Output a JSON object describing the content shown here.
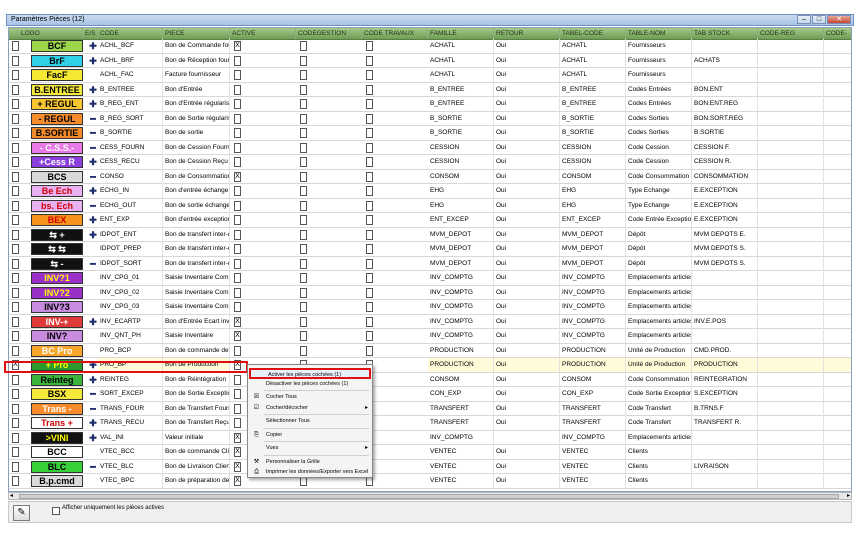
{
  "window": {
    "title": "Paramètres Pièces (12)",
    "min": "–",
    "max": "□",
    "close": "✕"
  },
  "columns": [
    "LOGO",
    "E/S",
    "CODE",
    "PIECE",
    "ACTIVE",
    "CODEGESTION",
    "CODE TRAVAUX",
    "FAMILLE",
    "RETOUR",
    "TABEL-CODE",
    "TABLE-NOM",
    "TAB STOCK",
    "CODE-REG",
    "CODE-"
  ],
  "rows": [
    {
      "logo": "BCF",
      "logo_bg": "#9ad54a",
      "logo_fg": "#000",
      "es": "✚",
      "code": "ACHL_BCF",
      "piece": "Bon de Commande fourni",
      "active": "X",
      "famille": "ACHATL",
      "retour": "Oui",
      "tabel": "ACHATL",
      "tnom": "Fournisseurs",
      "tstock": ""
    },
    {
      "logo": "BrF",
      "logo_bg": "#2fd0e8",
      "logo_fg": "#000",
      "es": "✚",
      "code": "ACHL_BRF",
      "piece": "Bon de Réception fournis",
      "active": "",
      "famille": "ACHATL",
      "retour": "Oui",
      "tabel": "ACHATL",
      "tnom": "Fournisseurs",
      "tstock": "ACHATS"
    },
    {
      "logo": "FacF",
      "logo_bg": "#f4e833",
      "logo_fg": "#000",
      "es": "",
      "code": "ACHL_FAC",
      "piece": "Facture fournisseur",
      "active": "",
      "famille": "ACHATL",
      "retour": "Oui",
      "tabel": "ACHATL",
      "tnom": "Fournisseurs",
      "tstock": ""
    },
    {
      "logo": "B.ENTREE",
      "logo_bg": "#f5e93c",
      "logo_fg": "#000",
      "es": "✚",
      "code": "B_ENTREE",
      "piece": "Bon d'Entrée",
      "active": "",
      "famille": "B_ENTREE",
      "retour": "Oui",
      "tabel": "B_ENTREE",
      "tnom": "Codes Entrées",
      "tstock": "BON.ENT"
    },
    {
      "logo": "+ REGUL",
      "logo_bg": "#f9c62f",
      "logo_fg": "#000",
      "es": "✚",
      "code": "B_REG_ENT",
      "piece": "Bon d'Entrée régularisatio",
      "active": "",
      "famille": "B_ENTREE",
      "retour": "Oui",
      "tabel": "B_ENTREE",
      "tnom": "Codes Entrées",
      "tstock": "BON.ENT.REG"
    },
    {
      "logo": "- REGUL",
      "logo_bg": "#f58b2a",
      "logo_fg": "#000",
      "es": "━",
      "code": "B_REG_SORT",
      "piece": "Bon de Sortie régularisati",
      "active": "",
      "famille": "B_SORTIE",
      "retour": "Oui",
      "tabel": "B_SORTIE",
      "tnom": "Codes Sorties",
      "tstock": "BON.SORT.REG"
    },
    {
      "logo": "B.SORTIE",
      "logo_bg": "#f58a2a",
      "logo_fg": "#000",
      "es": "━",
      "code": "B_SORTIE",
      "piece": "Bon de sortie",
      "active": "",
      "famille": "B_SORTIE",
      "retour": "Oui",
      "tabel": "B_SORTIE",
      "tnom": "Codes Sorties",
      "tstock": "B.SORTIE"
    },
    {
      "logo": "- C.S.S.-",
      "logo_bg": "#e979e9",
      "logo_fg": "#fff",
      "es": "━",
      "code": "CESS_FOURN",
      "piece": "Bon de Cession Fournie",
      "active": "",
      "famille": "CESSION",
      "retour": "Oui",
      "tabel": "CESSION",
      "tnom": "Code Cession",
      "tstock": "CESSION F."
    },
    {
      "logo": "+Cess R",
      "logo_bg": "#8a3fdc",
      "logo_fg": "#fff",
      "es": "✚",
      "code": "CESS_RECU",
      "piece": "Bon de Cession Reçu",
      "active": "",
      "famille": "CESSION",
      "retour": "Oui",
      "tabel": "CESSION",
      "tnom": "Code Cession",
      "tstock": "CESSION R."
    },
    {
      "logo": "BCS",
      "logo_bg": "#d9d9d9",
      "logo_fg": "#000",
      "es": "━",
      "code": "CONSO",
      "piece": "Bon de Consommation",
      "active": "X",
      "famille": "CONSOM",
      "retour": "Oui",
      "tabel": "CONSOM",
      "tnom": "Code Consommation",
      "tstock": "CONSOMMATION"
    },
    {
      "logo": "Be Ech",
      "logo_bg": "#e9b0f2",
      "logo_fg": "#c00",
      "es": "✚",
      "code": "ECHG_IN",
      "piece": "Bon d'entrée échange",
      "active": "",
      "famille": "EHG",
      "retour": "Oui",
      "tabel": "EHG",
      "tnom": "Type Echange",
      "tstock": "E.EXCEPTION"
    },
    {
      "logo": "bs. Ech",
      "logo_bg": "#e9b0f2",
      "logo_fg": "#c00",
      "es": "━",
      "code": "ECHG_OUT",
      "piece": "Bon de sortie échange",
      "active": "",
      "famille": "EHG",
      "retour": "Oui",
      "tabel": "EHG",
      "tnom": "Type Echange",
      "tstock": "E.EXCEPTION"
    },
    {
      "logo": "BEX",
      "logo_bg": "#f7941d",
      "logo_fg": "#c00",
      "es": "✚",
      "code": "ENT_EXP",
      "piece": "Bon d'entrée exception",
      "active": "",
      "famille": "ENT_EXCEP",
      "retour": "Oui",
      "tabel": "ENT_EXCEP",
      "tnom": "Code Entrée Exception",
      "tstock": "E.EXCEPTION"
    },
    {
      "logo": "⇆ +",
      "logo_bg": "#111",
      "logo_fg": "#fff",
      "es": "✚",
      "code": "IDPOT_ENT",
      "piece": "Bon de transfert inter-dép",
      "active": "",
      "famille": "MVM_DEPOT",
      "retour": "Oui",
      "tabel": "MVM_DEPOT",
      "tnom": "Dépôt",
      "tstock": "MVM DEPOTS E."
    },
    {
      "logo": "⇆ ⇆",
      "logo_bg": "#111",
      "logo_fg": "#fff",
      "es": "",
      "code": "IDPOT_PREP",
      "piece": "Bon de transfert inter-dép",
      "active": "",
      "famille": "MVM_DEPOT",
      "retour": "Oui",
      "tabel": "MVM_DEPOT",
      "tnom": "Dépôt",
      "tstock": "MVM DEPOTS S."
    },
    {
      "logo": "⇆ -",
      "logo_bg": "#111",
      "logo_fg": "#fff",
      "es": "━",
      "code": "IDPOT_SORT",
      "piece": "Bon de transfert inter-dép",
      "active": "",
      "famille": "MVM_DEPOT",
      "retour": "Oui",
      "tabel": "MVM_DEPOT",
      "tnom": "Dépôt",
      "tstock": "MVM DEPOTS S."
    },
    {
      "logo": "INV?1",
      "logo_bg": "#9b30c8",
      "logo_fg": "#ff0",
      "es": "",
      "code": "INV_CPG_01",
      "piece": "Saisie Inventaire Comptag",
      "active": "",
      "famille": "INV_COMPTG",
      "retour": "Oui",
      "tabel": "INV_COMPTG",
      "tnom": "Emplacements articles",
      "tstock": ""
    },
    {
      "logo": "INV?2",
      "logo_bg": "#9b30c8",
      "logo_fg": "#ff0",
      "es": "",
      "code": "INV_CPG_02",
      "piece": "Saisie Inventaire Comptag",
      "active": "",
      "famille": "INV_COMPTG",
      "retour": "Oui",
      "tabel": "INV_COMPTG",
      "tnom": "Emplacements articles",
      "tstock": ""
    },
    {
      "logo": "INV?3",
      "logo_bg": "#c98be0",
      "logo_fg": "#000",
      "es": "",
      "code": "INV_CPG_03",
      "piece": "Saisie Inventaire Comptag",
      "active": "",
      "famille": "INV_COMPTG",
      "retour": "Oui",
      "tabel": "INV_COMPTG",
      "tnom": "Emplacements articles",
      "tstock": ""
    },
    {
      "logo": "INV-+",
      "logo_bg": "#e03a3a",
      "logo_fg": "#fff",
      "es": "✚",
      "code": "INV_ECARTP",
      "piece": "Bon d'Entrée Ecart invent",
      "active": "X",
      "famille": "INV_COMPTG",
      "retour": "Oui",
      "tabel": "INV_COMPTG",
      "tnom": "Emplacements articles",
      "tstock": "INV.E.POS"
    },
    {
      "logo": "INV?",
      "logo_bg": "#c98be0",
      "logo_fg": "#000",
      "es": "",
      "code": "INV_QNT_PH",
      "piece": "Saisie Inventaire",
      "active": "X",
      "famille": "INV_COMPTG",
      "retour": "Oui",
      "tabel": "INV_COMPTG",
      "tnom": "Emplacements articles",
      "tstock": ""
    },
    {
      "logo": "BC Pro",
      "logo_bg": "#f7a52b",
      "logo_fg": "#fff",
      "es": "",
      "code": "PRO_BCP",
      "piece": "Bon de commande de Pro",
      "active": "",
      "famille": "PRODUCTION",
      "retour": "Oui",
      "tabel": "PRODUCTION",
      "tnom": "Unité de Production",
      "tstock": "CMD.PROD."
    },
    {
      "logo": "+ Pro",
      "logo_bg": "#2c9b2c",
      "logo_fg": "#ff0",
      "es": "✚",
      "code": "PRO_BP",
      "piece": "Bon de Production",
      "active": "X",
      "famille": "PRODUCTION",
      "retour": "Oui",
      "tabel": "PRODUCTION",
      "tnom": "Unité de Production",
      "tstock": "PRODUCTION",
      "first_chk": "X"
    },
    {
      "logo": "Reinteg",
      "logo_bg": "#3ab43a",
      "logo_fg": "#000",
      "es": "✚",
      "code": "REINTEG",
      "piece": "Bon de Réintégration",
      "active": "",
      "famille": "CONSOM",
      "retour": "Oui",
      "tabel": "CONSOM",
      "tnom": "Code Consommation",
      "tstock": "REINTEGRATION"
    },
    {
      "logo": "BSX",
      "logo_bg": "#f5e93c",
      "logo_fg": "#000",
      "es": "━",
      "code": "SORT_EXCEP",
      "piece": "Bon de Sortie Exception",
      "active": "",
      "famille": "CON_EXP",
      "retour": "Oui",
      "tabel": "CON_EXP",
      "tnom": "Code Sortie Exception",
      "tstock": "S.EXCEPTION"
    },
    {
      "logo": "Trans -",
      "logo_bg": "#f58b2a",
      "logo_fg": "#fff",
      "es": "━",
      "code": "TRANS_FOUR",
      "piece": "Bon de Transfert Fournie",
      "active": "",
      "famille": "TRANSFERT",
      "retour": "Oui",
      "tabel": "TRANSFERT",
      "tnom": "Code Transfert",
      "tstock": "B.TRNS.F"
    },
    {
      "logo": "Trans +",
      "logo_bg": "#fff",
      "logo_fg": "#c00",
      "es": "✚",
      "code": "TRANS_RECU",
      "piece": "Bon de Transfert Reçu",
      "active": "",
      "famille": "TRANSFERT",
      "retour": "Oui",
      "tabel": "TRANSFERT",
      "tnom": "Code Transfert",
      "tstock": "TRANSFERT R."
    },
    {
      "logo": ">VINI",
      "logo_bg": "#111",
      "logo_fg": "#ff0",
      "es": "✚",
      "code": "VAL_INI",
      "piece": "Valeur initiale",
      "active": "X",
      "famille": "INV_COMPTG",
      "retour": "",
      "tabel": "INV_COMPTG",
      "tnom": "Emplacements articles",
      "tstock": ""
    },
    {
      "logo": "BCC",
      "logo_bg": "#fff",
      "logo_fg": "#000",
      "es": "",
      "code": "VTEC_BCC",
      "piece": "Bon de commande Client",
      "active": "X",
      "famille": "VENTEC",
      "retour": "Oui",
      "tabel": "VENTEC",
      "tnom": "Clients",
      "tstock": ""
    },
    {
      "logo": "BLC",
      "logo_bg": "#39d139",
      "logo_fg": "#000",
      "es": "━",
      "code": "VTEC_BLC",
      "piece": "Bon de Livraison Client",
      "active": "X",
      "famille": "VENTEC",
      "retour": "Oui",
      "tabel": "VENTEC",
      "tnom": "Clients",
      "tstock": "LIVRAISON"
    },
    {
      "logo": "B.p.cmd",
      "logo_bg": "#d9d9d9",
      "logo_fg": "#000",
      "es": "",
      "code": "VTEC_BPC",
      "piece": "Bon de préparation de la c",
      "active": "X",
      "famille": "VENTEC",
      "retour": "Oui",
      "tabel": "VENTEC",
      "tnom": "Clients",
      "tstock": ""
    }
  ],
  "context_menu": [
    {
      "label": "Activer les pièces cochées (1)",
      "icon": ""
    },
    {
      "label": "Désactiver les pièces cochées (1)",
      "icon": ""
    },
    {
      "sep": true
    },
    {
      "label": "Cocher Tous",
      "icon": "☒"
    },
    {
      "label": "Cocher/décocher",
      "icon": "☑",
      "sub": true
    },
    {
      "sep": true
    },
    {
      "label": "Sélectionner Tous",
      "icon": ""
    },
    {
      "sep": true
    },
    {
      "label": "Copier",
      "icon": "⎘"
    },
    {
      "sep": true
    },
    {
      "label": "Vues",
      "icon": "",
      "sub": true
    },
    {
      "sep": true
    },
    {
      "label": "Personnaliser la Grille",
      "icon": "⚒"
    },
    {
      "label": "Imprimer les données/Exporter vers Excel",
      "icon": "⎙"
    }
  ],
  "footer": {
    "filter_label": "Afficher uniquement les pièces actives",
    "tool_icon": "✎"
  }
}
